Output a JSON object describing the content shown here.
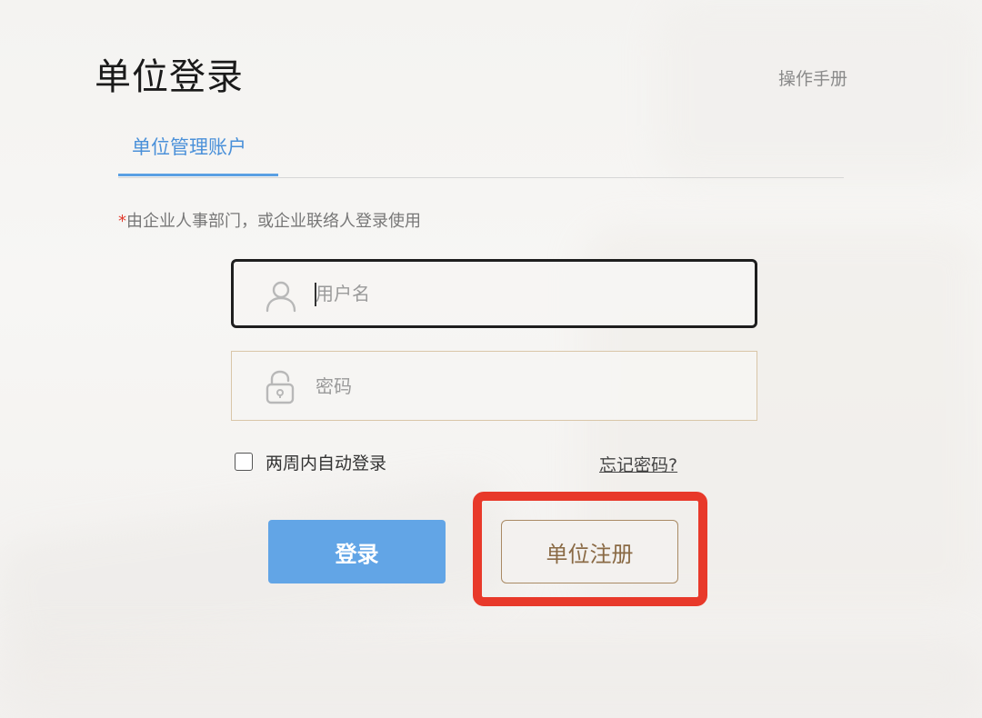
{
  "page": {
    "title": "单位登录",
    "manual_link": "操作手册"
  },
  "tabs": [
    {
      "label": "单位管理账户",
      "active": true
    }
  ],
  "notice": {
    "required_mark": "*",
    "text": "由企业人事部门，或企业联络人登录使用"
  },
  "form": {
    "username": {
      "placeholder": "用户名",
      "value": "",
      "icon": "user-icon"
    },
    "password": {
      "placeholder": "密码",
      "value": "",
      "icon": "lock-icon"
    },
    "remember": {
      "label": "两周内自动登录",
      "checked": false
    },
    "forgot_label": "忘记密码?",
    "login_label": "登录",
    "register_label": "单位注册"
  },
  "colors": {
    "accent_blue": "#5aa0e3",
    "login_button": "#62a5e6",
    "register_text": "#8a6a45",
    "highlight_red": "#e8392a",
    "required_star": "#e23a2c"
  }
}
